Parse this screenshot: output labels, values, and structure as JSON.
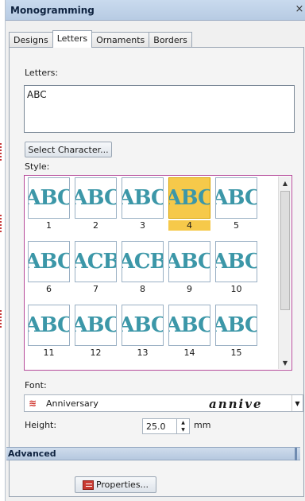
{
  "window": {
    "title": "Monogramming",
    "close_glyph": "×"
  },
  "tabs": [
    {
      "label": "Designs",
      "active": false
    },
    {
      "label": "Letters",
      "active": true
    },
    {
      "label": "Ornaments",
      "active": false
    },
    {
      "label": "Borders",
      "active": false
    }
  ],
  "letters": {
    "label": "Letters:",
    "value": "ABC",
    "select_button": "Select Character..."
  },
  "style": {
    "label": "Style:",
    "selected": 4,
    "items": [
      {
        "glyph": "ABC",
        "number": "1"
      },
      {
        "glyph": "ABC",
        "number": "2"
      },
      {
        "glyph": "ABC",
        "number": "3"
      },
      {
        "glyph": "ABC",
        "number": "4"
      },
      {
        "glyph": "ABC",
        "number": "5"
      },
      {
        "glyph": "ABC",
        "number": "6"
      },
      {
        "glyph": "ACB",
        "number": "7"
      },
      {
        "glyph": "ACB",
        "number": "8"
      },
      {
        "glyph": "ABC",
        "number": "9"
      },
      {
        "glyph": "ABC",
        "number": "10"
      },
      {
        "glyph": "ABC",
        "number": "11"
      },
      {
        "glyph": "ABC",
        "number": "12"
      },
      {
        "glyph": "ABC",
        "number": "13"
      },
      {
        "glyph": "ABC",
        "number": "14"
      },
      {
        "glyph": "ABC",
        "number": "15"
      }
    ]
  },
  "font": {
    "label": "Font:",
    "value": "Anniversary",
    "preview": "annive",
    "icon": "font-glyph-icon"
  },
  "height": {
    "label": "Height:",
    "value": "25.0",
    "unit": "mm"
  },
  "advanced": {
    "label": "Advanced"
  },
  "properties_button": "Properties...",
  "colors": {
    "title_bar": "#c9daee",
    "selected_style": "#f6c94a",
    "glyph": "#3c97a8",
    "grid_border": "#b54a9a"
  }
}
